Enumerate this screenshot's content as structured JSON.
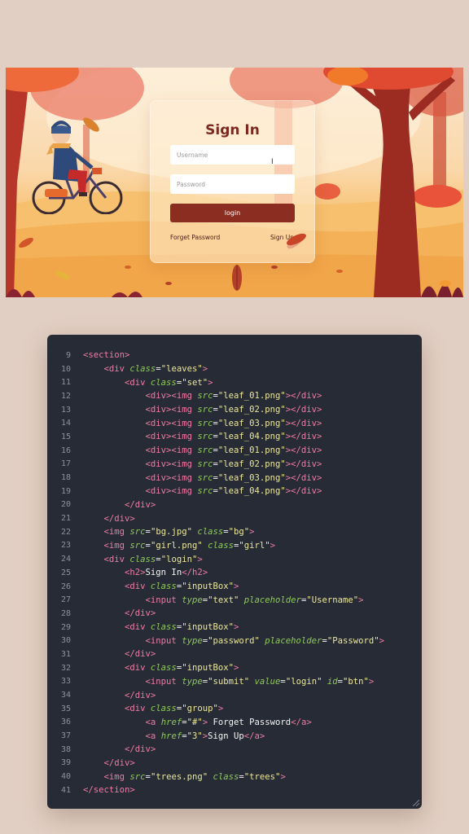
{
  "scene": {
    "login": {
      "title": "Sign In",
      "username_placeholder": "Username",
      "password_placeholder": "Password",
      "button_label": "login",
      "forget_link": "Forget Password",
      "signup_link": "Sign Up"
    }
  },
  "code": {
    "lines": [
      {
        "n": "9",
        "indent": "",
        "tokens": [
          [
            "tag",
            "<section>"
          ]
        ]
      },
      {
        "n": "10",
        "indent": "    ",
        "tokens": [
          [
            "tag",
            "<div "
          ],
          [
            "attr",
            "class"
          ],
          [
            "punc",
            "="
          ],
          [
            "str",
            "\"leaves\""
          ],
          [
            "tag",
            ">"
          ]
        ]
      },
      {
        "n": "11",
        "indent": "        ",
        "tokens": [
          [
            "tag",
            "<div "
          ],
          [
            "attr",
            "class"
          ],
          [
            "punc",
            "="
          ],
          [
            "str",
            "\"set\""
          ],
          [
            "tag",
            ">"
          ]
        ]
      },
      {
        "n": "12",
        "indent": "            ",
        "tokens": [
          [
            "tag",
            "<div><img "
          ],
          [
            "attr",
            "src"
          ],
          [
            "punc",
            "="
          ],
          [
            "str",
            "\"leaf_01.png\""
          ],
          [
            "tag",
            "></div>"
          ]
        ]
      },
      {
        "n": "13",
        "indent": "            ",
        "tokens": [
          [
            "tag",
            "<div><img "
          ],
          [
            "attr",
            "src"
          ],
          [
            "punc",
            "="
          ],
          [
            "str",
            "\"leaf_02.png\""
          ],
          [
            "tag",
            "></div>"
          ]
        ]
      },
      {
        "n": "14",
        "indent": "            ",
        "tokens": [
          [
            "tag",
            "<div><img "
          ],
          [
            "attr",
            "src"
          ],
          [
            "punc",
            "="
          ],
          [
            "str",
            "\"leaf_03.png\""
          ],
          [
            "tag",
            "></div>"
          ]
        ]
      },
      {
        "n": "15",
        "indent": "            ",
        "tokens": [
          [
            "tag",
            "<div><img "
          ],
          [
            "attr",
            "src"
          ],
          [
            "punc",
            "="
          ],
          [
            "str",
            "\"leaf_04.png\""
          ],
          [
            "tag",
            "></div>"
          ]
        ]
      },
      {
        "n": "16",
        "indent": "            ",
        "tokens": [
          [
            "tag",
            "<div><img "
          ],
          [
            "attr",
            "src"
          ],
          [
            "punc",
            "="
          ],
          [
            "str",
            "\"leaf_01.png\""
          ],
          [
            "tag",
            "></div>"
          ]
        ]
      },
      {
        "n": "17",
        "indent": "            ",
        "tokens": [
          [
            "tag",
            "<div><img "
          ],
          [
            "attr",
            "src"
          ],
          [
            "punc",
            "="
          ],
          [
            "str",
            "\"leaf_02.png\""
          ],
          [
            "tag",
            "></div>"
          ]
        ]
      },
      {
        "n": "18",
        "indent": "            ",
        "tokens": [
          [
            "tag",
            "<div><img "
          ],
          [
            "attr",
            "src"
          ],
          [
            "punc",
            "="
          ],
          [
            "str",
            "\"leaf_03.png\""
          ],
          [
            "tag",
            "></div>"
          ]
        ]
      },
      {
        "n": "19",
        "indent": "            ",
        "tokens": [
          [
            "tag",
            "<div><img "
          ],
          [
            "attr",
            "src"
          ],
          [
            "punc",
            "="
          ],
          [
            "str",
            "\"leaf_04.png\""
          ],
          [
            "tag",
            "></div>"
          ]
        ]
      },
      {
        "n": "20",
        "indent": "        ",
        "tokens": [
          [
            "tag",
            "</div>"
          ]
        ]
      },
      {
        "n": "21",
        "indent": "    ",
        "tokens": [
          [
            "tag",
            "</div>"
          ]
        ]
      },
      {
        "n": "22",
        "indent": "    ",
        "tokens": [
          [
            "tag",
            "<img "
          ],
          [
            "attr",
            "src"
          ],
          [
            "punc",
            "="
          ],
          [
            "str",
            "\"bg.jpg\""
          ],
          [
            "punc",
            " "
          ],
          [
            "attr",
            "class"
          ],
          [
            "punc",
            "="
          ],
          [
            "str",
            "\"bg\""
          ],
          [
            "tag",
            ">"
          ]
        ]
      },
      {
        "n": "23",
        "indent": "    ",
        "tokens": [
          [
            "tag",
            "<img "
          ],
          [
            "attr",
            "src"
          ],
          [
            "punc",
            "="
          ],
          [
            "str",
            "\"girl.png\""
          ],
          [
            "punc",
            " "
          ],
          [
            "attr",
            "class"
          ],
          [
            "punc",
            "="
          ],
          [
            "str",
            "\"girl\""
          ],
          [
            "tag",
            ">"
          ]
        ]
      },
      {
        "n": "24",
        "indent": "    ",
        "tokens": [
          [
            "tag",
            "<div "
          ],
          [
            "attr",
            "class"
          ],
          [
            "punc",
            "="
          ],
          [
            "str",
            "\"login\""
          ],
          [
            "tag",
            ">"
          ]
        ]
      },
      {
        "n": "25",
        "indent": "        ",
        "tokens": [
          [
            "tag",
            "<h2>"
          ],
          [
            "text",
            "Sign In"
          ],
          [
            "tag",
            "</h2>"
          ]
        ]
      },
      {
        "n": "26",
        "indent": "        ",
        "tokens": [
          [
            "tag",
            "<div "
          ],
          [
            "attr",
            "class"
          ],
          [
            "punc",
            "="
          ],
          [
            "str",
            "\"inputBox\""
          ],
          [
            "tag",
            ">"
          ]
        ]
      },
      {
        "n": "27",
        "indent": "            ",
        "tokens": [
          [
            "tag",
            "<input "
          ],
          [
            "attr",
            "type"
          ],
          [
            "punc",
            "="
          ],
          [
            "str",
            "\"text\""
          ],
          [
            "punc",
            " "
          ],
          [
            "attr",
            "placeholder"
          ],
          [
            "punc",
            "="
          ],
          [
            "str",
            "\"Username\""
          ],
          [
            "tag",
            ">"
          ]
        ]
      },
      {
        "n": "28",
        "indent": "        ",
        "tokens": [
          [
            "tag",
            "</div>"
          ]
        ]
      },
      {
        "n": "29",
        "indent": "        ",
        "tokens": [
          [
            "tag",
            "<div "
          ],
          [
            "attr",
            "class"
          ],
          [
            "punc",
            "="
          ],
          [
            "str",
            "\"inputBox\""
          ],
          [
            "tag",
            ">"
          ]
        ]
      },
      {
        "n": "30",
        "indent": "            ",
        "tokens": [
          [
            "tag",
            "<input "
          ],
          [
            "attr",
            "type"
          ],
          [
            "punc",
            "="
          ],
          [
            "str",
            "\"password\""
          ],
          [
            "punc",
            " "
          ],
          [
            "attr",
            "placeholder"
          ],
          [
            "punc",
            "="
          ],
          [
            "str",
            "\"Password\""
          ],
          [
            "tag",
            ">"
          ]
        ]
      },
      {
        "n": "31",
        "indent": "        ",
        "tokens": [
          [
            "tag",
            "</div>"
          ]
        ]
      },
      {
        "n": "32",
        "indent": "        ",
        "tokens": [
          [
            "tag",
            "<div "
          ],
          [
            "attr",
            "class"
          ],
          [
            "punc",
            "="
          ],
          [
            "str",
            "\"inputBox\""
          ],
          [
            "tag",
            ">"
          ]
        ]
      },
      {
        "n": "33",
        "indent": "            ",
        "tokens": [
          [
            "tag",
            "<input "
          ],
          [
            "attr",
            "type"
          ],
          [
            "punc",
            "="
          ],
          [
            "str",
            "\"submit\""
          ],
          [
            "punc",
            " "
          ],
          [
            "attr",
            "value"
          ],
          [
            "punc",
            "="
          ],
          [
            "str",
            "\"login\""
          ],
          [
            "punc",
            " "
          ],
          [
            "attr",
            "id"
          ],
          [
            "punc",
            "="
          ],
          [
            "str",
            "\"btn\""
          ],
          [
            "tag",
            ">"
          ]
        ]
      },
      {
        "n": "34",
        "indent": "        ",
        "tokens": [
          [
            "tag",
            "</div>"
          ]
        ]
      },
      {
        "n": "35",
        "indent": "        ",
        "tokens": [
          [
            "tag",
            "<div "
          ],
          [
            "attr",
            "class"
          ],
          [
            "punc",
            "="
          ],
          [
            "str",
            "\"group\""
          ],
          [
            "tag",
            ">"
          ]
        ]
      },
      {
        "n": "36",
        "indent": "            ",
        "tokens": [
          [
            "tag",
            "<a "
          ],
          [
            "attr",
            "href"
          ],
          [
            "punc",
            "="
          ],
          [
            "str",
            "\"#\""
          ],
          [
            "tag",
            ">"
          ],
          [
            "text",
            " Forget Password"
          ],
          [
            "tag",
            "</a>"
          ]
        ]
      },
      {
        "n": "37",
        "indent": "            ",
        "tokens": [
          [
            "tag",
            "<a "
          ],
          [
            "attr",
            "href"
          ],
          [
            "punc",
            "="
          ],
          [
            "str",
            "\"3\""
          ],
          [
            "tag",
            ">"
          ],
          [
            "text",
            "Sign Up"
          ],
          [
            "tag",
            "</a>"
          ]
        ]
      },
      {
        "n": "38",
        "indent": "        ",
        "tokens": [
          [
            "tag",
            "</div>"
          ]
        ]
      },
      {
        "n": "39",
        "indent": "    ",
        "tokens": [
          [
            "tag",
            "</div>"
          ]
        ]
      },
      {
        "n": "40",
        "indent": "    ",
        "tokens": [
          [
            "tag",
            "<img "
          ],
          [
            "attr",
            "src"
          ],
          [
            "punc",
            "="
          ],
          [
            "str",
            "\"trees.png\""
          ],
          [
            "punc",
            " "
          ],
          [
            "attr",
            "class"
          ],
          [
            "punc",
            "="
          ],
          [
            "str",
            "\"trees\""
          ],
          [
            "tag",
            ">"
          ]
        ]
      },
      {
        "n": "41",
        "indent": "",
        "tokens": [
          [
            "tag",
            "</section>"
          ]
        ]
      }
    ]
  },
  "colors": {
    "page_bg": "#e2cfc3",
    "code_bg": "#262b35",
    "tag": "#ef7ba6",
    "attr": "#90c95c",
    "string": "#ece79a",
    "button": "#8b2d20",
    "title": "#7b2a22"
  },
  "icons": [
    "text-cursor-icon",
    "resize-grip-icon",
    "falling-leaf-icon"
  ]
}
